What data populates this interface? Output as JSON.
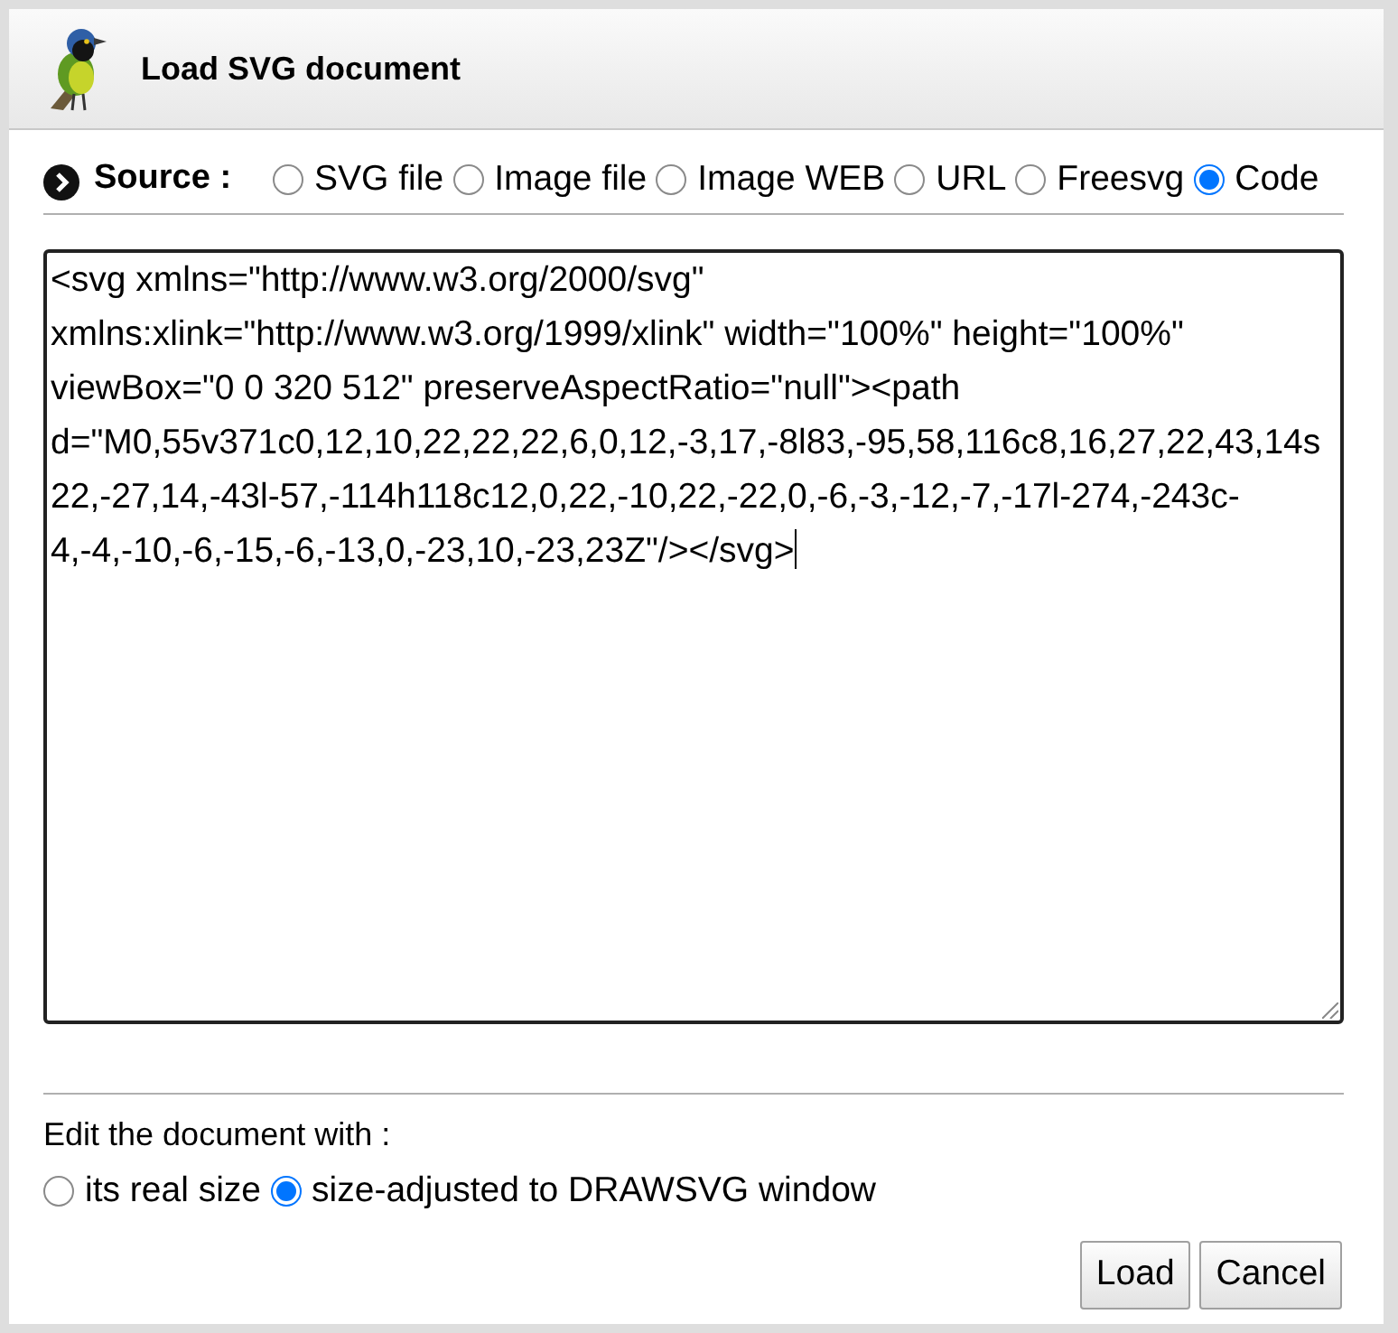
{
  "dialog": {
    "title": "Load SVG document"
  },
  "source": {
    "label": "Source :",
    "options": [
      {
        "label": "SVG file",
        "selected": false
      },
      {
        "label": "Image file",
        "selected": false
      },
      {
        "label": "Image WEB",
        "selected": false
      },
      {
        "label": "URL",
        "selected": false
      },
      {
        "label": "Freesvg",
        "selected": false
      },
      {
        "label": "Code",
        "selected": true
      }
    ]
  },
  "code": {
    "value": "<svg xmlns=\"http://www.w3.org/2000/svg\" xmlns:xlink=\"http://www.w3.org/1999/xlink\" width=\"100%\" height=\"100%\" viewBox=\"0 0 320 512\" preserveAspectRatio=\"null\"><path d=\"M0,55v371c0,12,10,22,22,22,6,0,12,-3,17,-8l83,-95,58,116c8,16,27,22,43,14s22,-27,14,-43l-57,-114h118c12,0,22,-10,22,-22,0,-6,-3,-12,-7,-17l-274,-243c-4,-4,-10,-6,-15,-6,-13,0,-23,10,-23,23Z\"/></svg>"
  },
  "edit": {
    "label": "Edit the document with :",
    "options": [
      {
        "label": "its real size",
        "selected": false
      },
      {
        "label": "size-adjusted to DRAWSVG window",
        "selected": true
      }
    ]
  },
  "buttons": [
    "Load",
    "Cancel"
  ]
}
